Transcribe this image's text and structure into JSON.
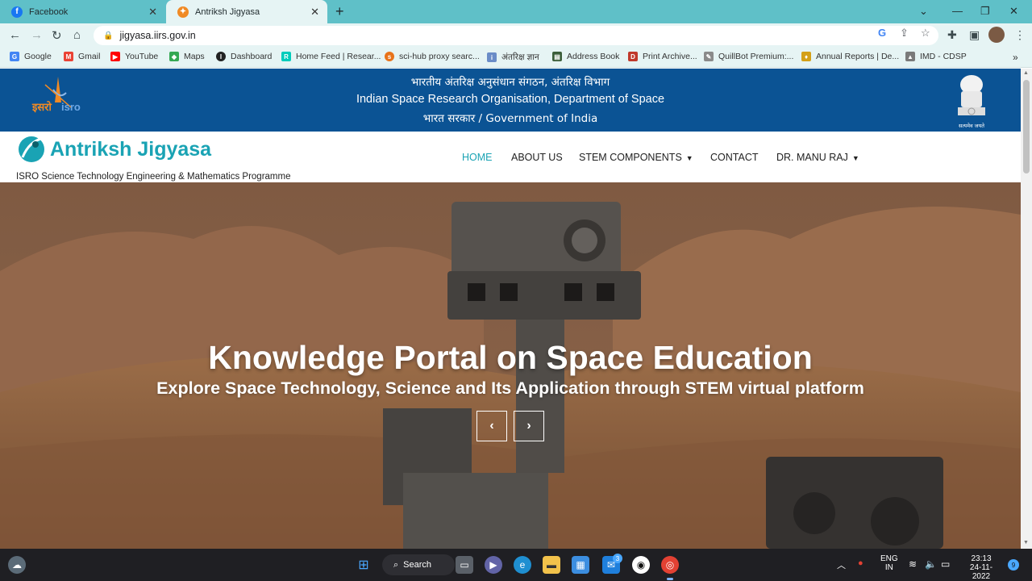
{
  "browser": {
    "tabs": [
      {
        "title": "Facebook",
        "active": false
      },
      {
        "title": "Antriksh Jigyasa",
        "active": true
      }
    ],
    "url": "jigyasa.iirs.gov.in",
    "bookmarks": [
      "Google",
      "Gmail",
      "YouTube",
      "Maps",
      "Dashboard",
      "Home Feed | Resear...",
      "sci-hub proxy searc...",
      "अंतरिक्ष ज्ञान",
      "Address Book",
      "Print Archive...",
      "QuillBot Premium:...",
      "Annual Reports | De...",
      "IMD - CDSP"
    ]
  },
  "gov_header": {
    "line_hindi": "भारतीय अंतरिक्ष अनुसंधान संगठन, अंतरिक्ष विभाग",
    "line_english": "Indian Space Research Organisation, Department of Space",
    "line_gov": "भारत सरकार / Government of India",
    "logo_hindi": "इसरो",
    "logo_english": "isro",
    "emblem_motto": "सत्यमेव जयते"
  },
  "site": {
    "brand": "Antriksh Jigyasa",
    "tagline": "ISRO Science Technology Engineering & Mathematics Programme",
    "nav": [
      "HOME",
      "ABOUT US",
      "STEM COMPONENTS",
      "CONTACT",
      "DR. MANU RAJ"
    ]
  },
  "hero": {
    "title": "Knowledge Portal on Space Education",
    "subtitle": "Explore Space Technology, Science and Its Application through STEM virtual platform",
    "prev": "‹",
    "next": "›"
  },
  "taskbar": {
    "search": "Search",
    "lang_top": "ENG",
    "lang_bottom": "IN",
    "time": "23:13",
    "date": "24-11-2022",
    "notifications": "9",
    "mail_badge": "3"
  },
  "colors": {
    "gov_band": "#0b5394",
    "brand_teal": "#1aa3b4",
    "tab_bar": "#5fc0c8"
  }
}
